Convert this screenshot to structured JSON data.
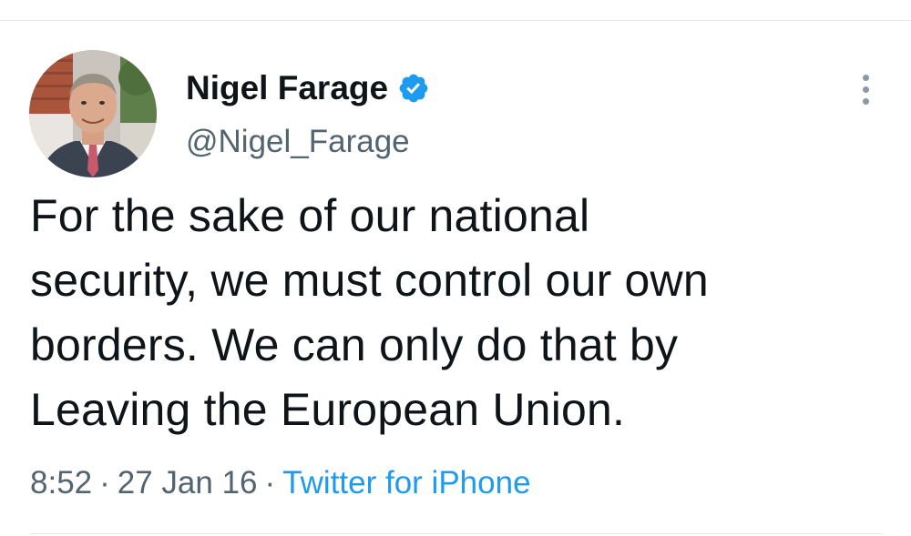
{
  "tweet": {
    "author": {
      "display_name": "Nigel Farage",
      "handle": "@Nigel_Farage",
      "verified": true
    },
    "text_lines": [
      "For the sake of our national",
      "security, we must control our own",
      "borders. We can only do that by",
      "Leaving the European Union."
    ],
    "time": "8:52",
    "separator": "·",
    "date": "27 Jan 16",
    "source": "Twitter for iPhone"
  },
  "icons": {
    "verified": "verified-badge-icon",
    "more": "more-options-icon"
  },
  "colors": {
    "text_primary": "#0f1419",
    "text_secondary": "#536471",
    "link": "#1d9bf0",
    "verified_badge": "#1d9bf0",
    "divider": "#e7e9ea"
  }
}
